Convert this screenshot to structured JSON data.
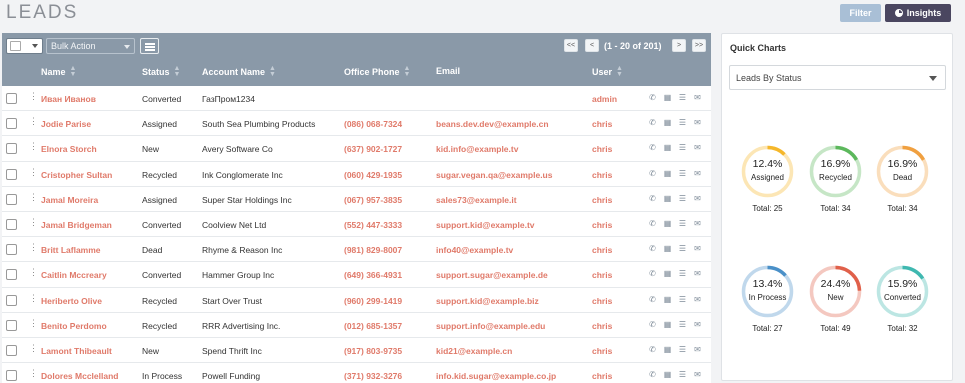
{
  "page": {
    "title": "LEADS"
  },
  "header": {
    "filter_label": "Filter",
    "insights_label": "Insights"
  },
  "toolbar": {
    "bulk_action": "Bulk Action",
    "pagination": {
      "first": "<<",
      "prev": "<",
      "info": "(1 - 20 of 201)",
      "next": ">",
      "last": ">>"
    }
  },
  "table": {
    "columns": [
      "Name",
      "Status",
      "Account Name",
      "Office Phone",
      "Email",
      "User"
    ],
    "rows": [
      {
        "name": "Иван Иванов",
        "status": "Converted",
        "account": "ГазПром1234",
        "phone": "",
        "email": "",
        "user": "admin"
      },
      {
        "name": "Jodie Parise",
        "status": "Assigned",
        "account": "South Sea Plumbing Products",
        "phone": "(086) 068-7324",
        "email": "beans.dev.dev@example.cn",
        "user": "chris"
      },
      {
        "name": "Elnora Storch",
        "status": "New",
        "account": "Avery Software Co",
        "phone": "(637) 902-1727",
        "email": "kid.info@example.tv",
        "user": "chris"
      },
      {
        "name": "Cristopher Sultan",
        "status": "Recycled",
        "account": "Ink Conglomerate Inc",
        "phone": "(060) 429-1935",
        "email": "sugar.vegan.qa@example.us",
        "user": "chris"
      },
      {
        "name": "Jamal Moreira",
        "status": "Assigned",
        "account": "Super Star Holdings Inc",
        "phone": "(067) 957-3835",
        "email": "sales73@example.it",
        "user": "chris"
      },
      {
        "name": "Jamal Bridgeman",
        "status": "Converted",
        "account": "Coolview Net Ltd",
        "phone": "(552) 447-3333",
        "email": "support.kid@example.tv",
        "user": "chris"
      },
      {
        "name": "Britt Laflamme",
        "status": "Dead",
        "account": "Rhyme & Reason Inc",
        "phone": "(981) 829-8007",
        "email": "info40@example.tv",
        "user": "chris"
      },
      {
        "name": "Caitlin Mccreary",
        "status": "Converted",
        "account": "Hammer Group Inc",
        "phone": "(649) 366-4931",
        "email": "support.sugar@example.de",
        "user": "chris"
      },
      {
        "name": "Heriberto Olive",
        "status": "Recycled",
        "account": "Start Over Trust",
        "phone": "(960) 299-1419",
        "email": "support.kid@example.biz",
        "user": "chris"
      },
      {
        "name": "Benito Perdomo",
        "status": "Recycled",
        "account": "RRR Advertising Inc.",
        "phone": "(012) 685-1357",
        "email": "support.info@example.edu",
        "user": "chris"
      },
      {
        "name": "Lamont Thibeault",
        "status": "New",
        "account": "Spend Thrift Inc",
        "phone": "(917) 803-9735",
        "email": "kid21@example.cn",
        "user": "chris"
      },
      {
        "name": "Dolores Mcclelland",
        "status": "In Process",
        "account": "Powell Funding",
        "phone": "(371) 932-3276",
        "email": "info.kid.sugar@example.co.jp",
        "user": "chris"
      }
    ]
  },
  "quick_charts": {
    "title": "Quick Charts",
    "selected": "Leads By Status",
    "items": [
      {
        "pct": "12.4%",
        "label": "Assigned",
        "total": "Total: 25",
        "fraction": 0.124,
        "color": "#f5b72b"
      },
      {
        "pct": "16.9%",
        "label": "Recycled",
        "total": "Total: 34",
        "fraction": 0.169,
        "color": "#5cb85c"
      },
      {
        "pct": "16.9%",
        "label": "Dead",
        "total": "Total: 34",
        "fraction": 0.169,
        "color": "#f0a040"
      },
      {
        "pct": "13.4%",
        "label": "In Process",
        "total": "Total: 27",
        "fraction": 0.134,
        "color": "#4a90c8"
      },
      {
        "pct": "24.4%",
        "label": "New",
        "total": "Total: 49",
        "fraction": 0.244,
        "color": "#e0604a"
      },
      {
        "pct": "15.9%",
        "label": "Converted",
        "total": "Total: 32",
        "fraction": 0.159,
        "color": "#3fb8b0"
      }
    ]
  }
}
